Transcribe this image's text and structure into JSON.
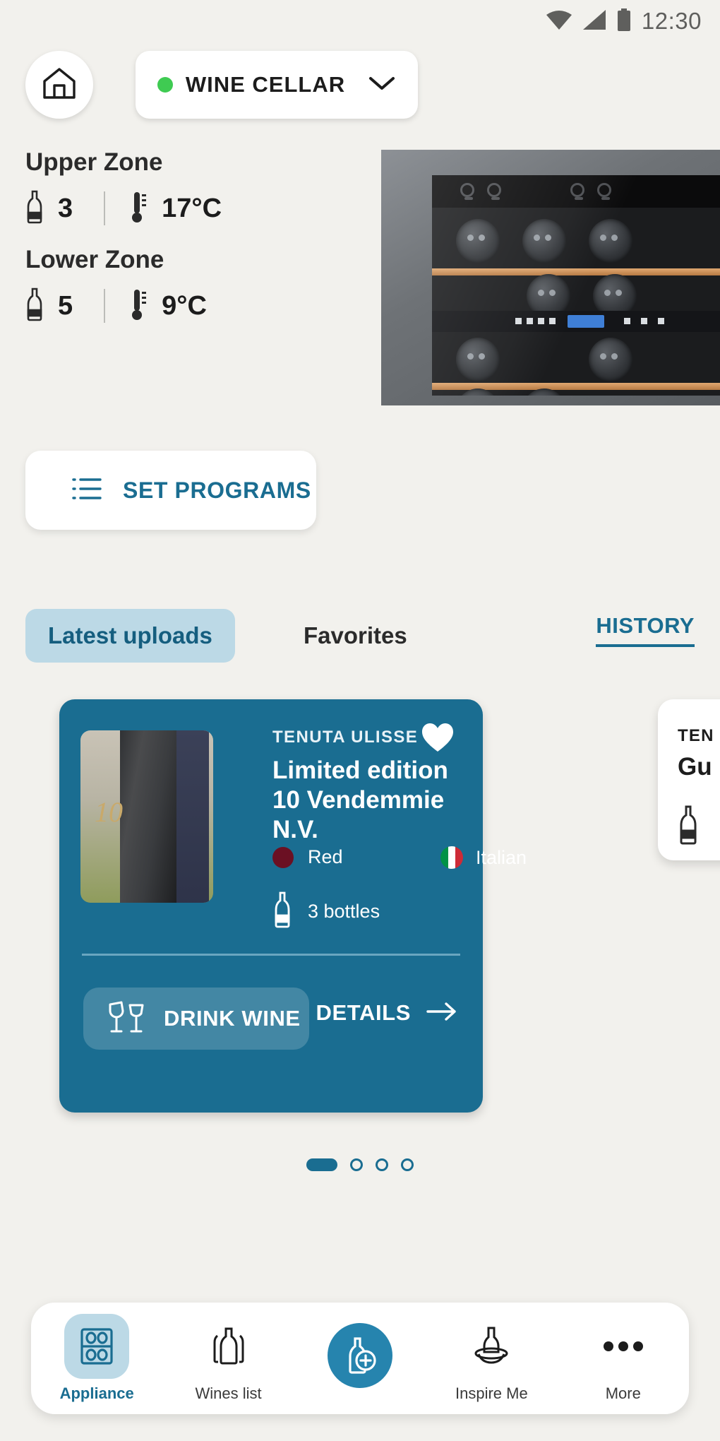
{
  "statusbar": {
    "time": "12:30",
    "icons": [
      "wifi-icon",
      "cellular-signal-icon",
      "battery-icon"
    ]
  },
  "header": {
    "home_button": "home-icon",
    "device": {
      "name": "WINE CELLAR",
      "status_color": "#3fcb52",
      "chevron": "chevron-down-icon"
    }
  },
  "zones": [
    {
      "title": "Upper Zone",
      "bottles": "3",
      "temperature": "17°C",
      "bottle_icon": "bottle-icon",
      "temp_icon": "thermometer-icon"
    },
    {
      "title": "Lower Zone",
      "bottles": "5",
      "temperature": "9°C",
      "bottle_icon": "bottle-icon",
      "temp_icon": "thermometer-icon"
    }
  ],
  "set_programs": {
    "label": "SET PROGRAMS",
    "icon": "list-icon",
    "color": "#1a6d91"
  },
  "tabs": [
    {
      "label": "Latest uploads",
      "selected": true
    },
    {
      "label": "Favorites",
      "selected": false
    }
  ],
  "history_link": {
    "label": "HISTORY"
  },
  "wine_cards": [
    {
      "brand": "TENUTA ULISSE",
      "title": "Limited edition 10 Vendemmie N.V.",
      "color_label": "Red",
      "color_swatch": "#6b1023",
      "country_label": "Italian",
      "country_flag": "italian-flag-icon",
      "bottles_label": "3 bottles",
      "favorite": true,
      "card_color": "#1a6d91",
      "actions": {
        "drink_label": "DRINK WINE",
        "drink_icon": "cheers-glasses-icon",
        "details_label": "DETAILS",
        "details_icon": "arrow-right-icon"
      }
    },
    {
      "brand": "TEN",
      "title": "Gu",
      "bottle_icon": "bottle-icon"
    }
  ],
  "pagination": {
    "total": 4,
    "active_index": 0
  },
  "bottom_nav": [
    {
      "label": "Appliance",
      "icon": "wine-cellar-icon",
      "active": true
    },
    {
      "label": "Wines list",
      "icon": "bottles-icon",
      "active": false
    },
    {
      "label": "",
      "icon": "add-bottle-icon",
      "fab": true
    },
    {
      "label": "Inspire Me",
      "icon": "bottle-decanter-icon",
      "active": false
    },
    {
      "label": "More",
      "icon": "more-dots-icon",
      "active": false
    }
  ]
}
